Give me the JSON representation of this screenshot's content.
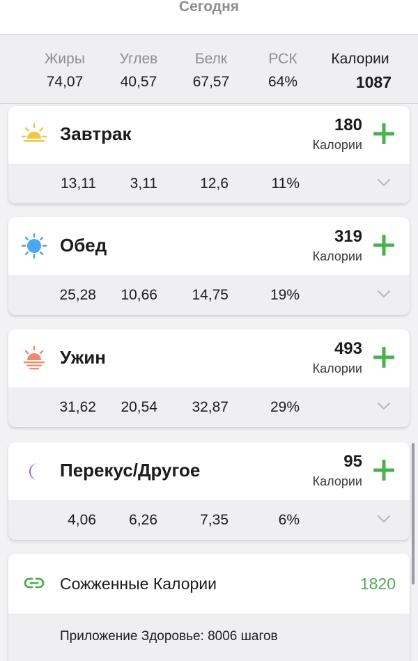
{
  "header": {
    "title": "Сегодня"
  },
  "summary": {
    "columns": [
      {
        "label": "Жиры",
        "value": "74,07"
      },
      {
        "label": "Углев",
        "value": "40,57"
      },
      {
        "label": "Белк",
        "value": "67,57"
      },
      {
        "label": "РСК",
        "value": "64%"
      },
      {
        "label": "Калории",
        "value": "1087"
      }
    ]
  },
  "meals": [
    {
      "name": "Завтрак",
      "calories": "180",
      "calories_label": "Калории",
      "icon": "sunrise-icon",
      "macros": [
        "13,11",
        "3,11",
        "12,6",
        "11%"
      ]
    },
    {
      "name": "Обед",
      "calories": "319",
      "calories_label": "Калории",
      "icon": "sun-icon",
      "macros": [
        "25,28",
        "10,66",
        "14,75",
        "19%"
      ]
    },
    {
      "name": "Ужин",
      "calories": "493",
      "calories_label": "Калории",
      "icon": "sunset-icon",
      "macros": [
        "31,62",
        "20,54",
        "32,87",
        "29%"
      ]
    },
    {
      "name": "Перекус/Другое",
      "calories": "95",
      "calories_label": "Калории",
      "icon": "moon-icon",
      "macros": [
        "4,06",
        "6,26",
        "7,35",
        "6%"
      ]
    }
  ],
  "burned": {
    "label": "Сожженные Калории",
    "value": "1820",
    "health_text": "Приложение Здоровье: 8006 шагов"
  },
  "colors": {
    "accent_green": "#4caf50",
    "sunrise": "#f4c542",
    "sun": "#4aa8f0",
    "sunset": "#f08a6a",
    "moon": "#9b59c4"
  }
}
